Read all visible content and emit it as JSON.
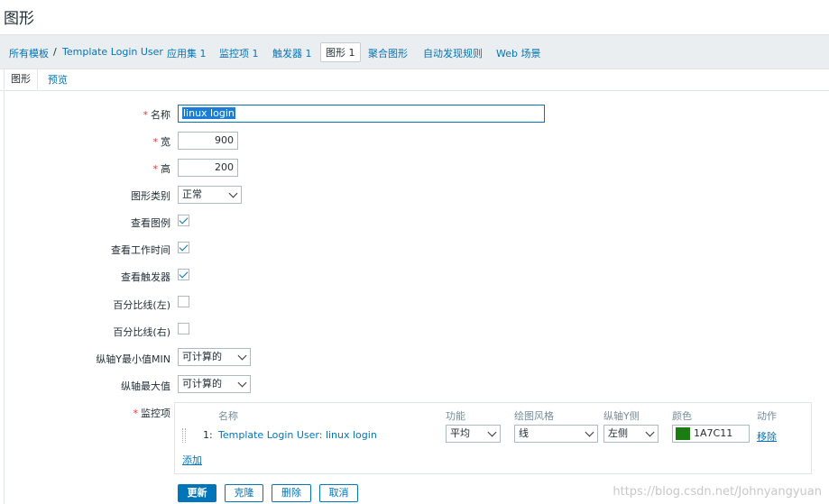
{
  "page_title": "图形",
  "breadcrumb": {
    "all_templates": "所有模板",
    "separator": "/",
    "template": "Template Login User",
    "items": [
      "应用集 1",
      "监控项 1",
      "触发器 1",
      "图形 1",
      "聚合图形",
      "自动发现规则",
      "Web 场景"
    ]
  },
  "tabs": [
    "图形",
    "预览"
  ],
  "form": {
    "name_label": "名称",
    "name_value": "linux login",
    "width_label": "宽",
    "width_value": "900",
    "height_label": "高",
    "height_value": "200",
    "graph_type_label": "图形类别",
    "graph_type_value": "正常",
    "show_legend_label": "查看图例",
    "show_legend": true,
    "show_working_time_label": "查看工作时间",
    "show_working_time": true,
    "show_triggers_label": "查看触发器",
    "show_triggers": true,
    "percentile_left_label": "百分比线(左)",
    "percentile_left": false,
    "percentile_right_label": "百分比线(右)",
    "percentile_right": false,
    "ymin_label": "纵轴Y最小值MIN",
    "ymin_value": "可计算的",
    "ymax_label": "纵轴最大值",
    "ymax_value": "可计算的",
    "items_label": "监控项"
  },
  "items_table": {
    "headers": {
      "name": "名称",
      "function": "功能",
      "draw_style": "绘图风格",
      "y_axis_side": "纵轴Y侧",
      "color": "颜色",
      "action": "动作"
    },
    "rows": [
      {
        "index": "1:",
        "name": "Template Login User: linux login",
        "function": "平均",
        "draw_style": "线",
        "y_axis_side": "左侧",
        "color": "1A7C11",
        "action": "移除"
      }
    ],
    "add_link": "添加"
  },
  "buttons": {
    "update": "更新",
    "clone": "克隆",
    "delete": "删除",
    "cancel": "取消"
  },
  "watermark": "https://blog.csdn.net/Johnyangyuan",
  "colors": {
    "accent": "#0275b8",
    "item_color": "#1A7C11",
    "required": "#e33734"
  }
}
